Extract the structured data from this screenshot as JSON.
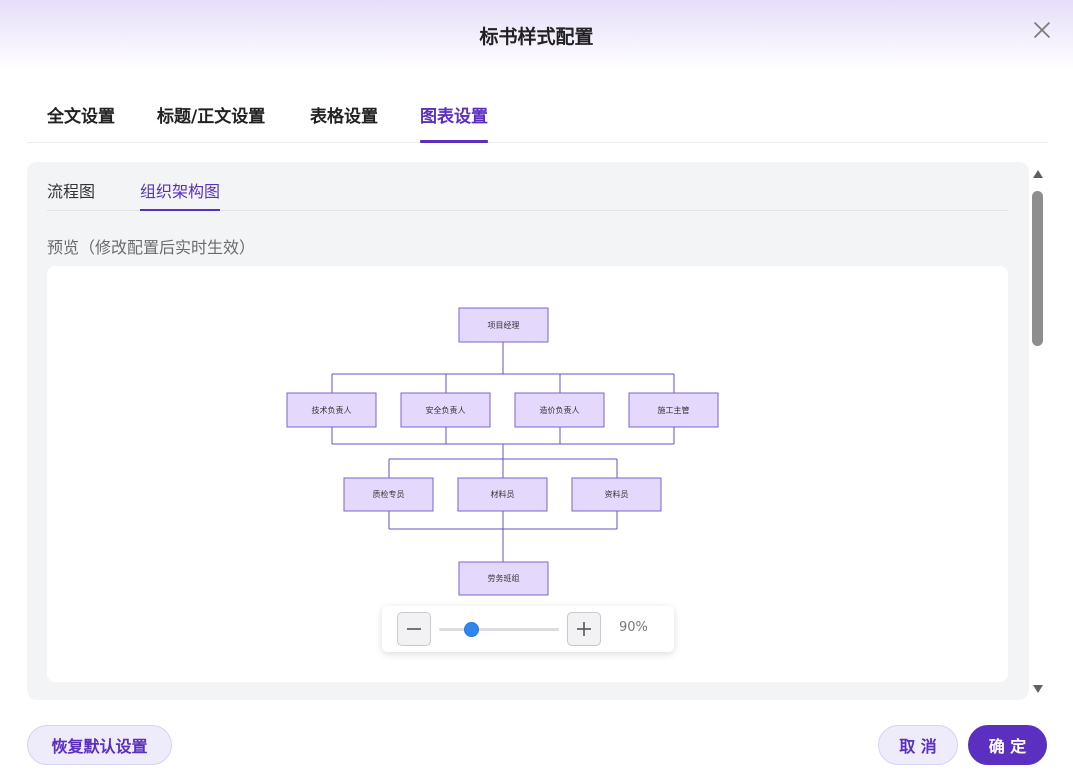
{
  "dialog": {
    "title": "标书样式配置"
  },
  "main_tabs": [
    {
      "label": "全文设置"
    },
    {
      "label": "标题/正文设置"
    },
    {
      "label": "表格设置"
    },
    {
      "label": "图表设置"
    }
  ],
  "sub_tabs": [
    {
      "label": "流程图"
    },
    {
      "label": "组织架构图"
    }
  ],
  "preview": {
    "label": "预览（修改配置后实时生效）"
  },
  "org_chart": {
    "root": "项目经理",
    "level2": [
      "技术负责人",
      "安全负责人",
      "造价负责人",
      "施工主管"
    ],
    "level3": [
      "质检专员",
      "材料员",
      "资料员"
    ],
    "level4": "劳务班组"
  },
  "zoom": {
    "value_label": "90%",
    "level_percent": 90
  },
  "footer": {
    "reset_label": "恢复默认设置",
    "cancel_label": "取 消",
    "confirm_label": "确 定"
  },
  "colors": {
    "accent": "#5b2fc0",
    "node_fill": "#e4d9fc",
    "node_stroke": "#7b63cf",
    "slider_thumb": "#2f86ef"
  },
  "icons": {
    "close": "close-icon",
    "zoom_out": "minus-icon",
    "zoom_in": "plus-icon",
    "scroll_up": "triangle-up-icon",
    "scroll_down": "triangle-down-icon"
  }
}
